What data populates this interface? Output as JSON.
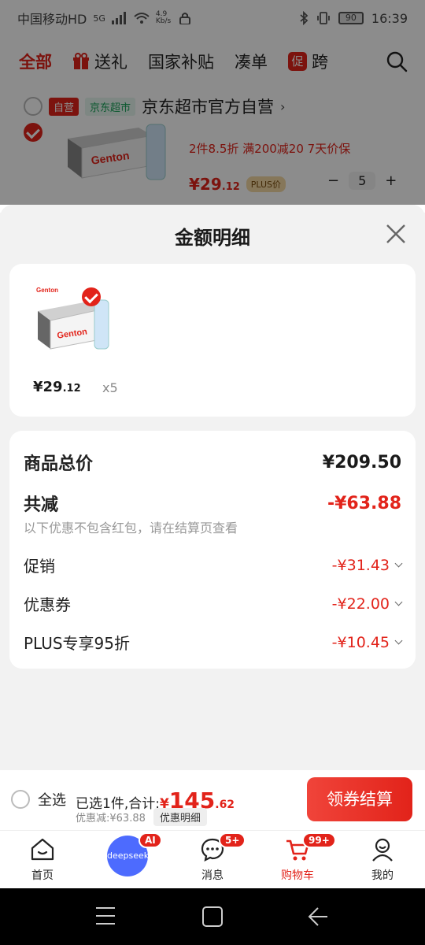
{
  "status_bar": {
    "carrier": "中国移动HD",
    "signal": "5G",
    "speed": "4.9 Kb/s",
    "battery": "90",
    "time": "16:39"
  },
  "top_tabs": [
    {
      "label": "全部",
      "active": true
    },
    {
      "label": "送礼",
      "icon": "gift-icon"
    },
    {
      "label": "国家补贴"
    },
    {
      "label": "凑单"
    },
    {
      "label": "跨",
      "badge": "促"
    }
  ],
  "cart_bg": {
    "self_badge": "自营",
    "jd_badge": "京东超市",
    "store_name": "京东超市官方自营",
    "promo": "2件8.5折   满200减20   7天价保",
    "price_symbol": "¥",
    "price_int": "29",
    "price_dec": ".12",
    "plus_badge": "PLUS价",
    "quantity": "5"
  },
  "sheet": {
    "title": "金额明细",
    "item": {
      "price_symbol": "¥",
      "price_int": "29",
      "price_dec": ".12",
      "qty": "x5"
    },
    "summary": {
      "total_label": "商品总价",
      "total_value": "¥209.50",
      "reduce_label": "共减",
      "reduce_value": "-¥63.88",
      "note": "以下优惠不包含红包，请在结算页查看",
      "rows": [
        {
          "label": "促销",
          "value": "-¥31.43"
        },
        {
          "label": "优惠券",
          "value": "-¥22.00"
        },
        {
          "label": "PLUS专享95折",
          "value": "-¥10.45"
        }
      ]
    }
  },
  "bottom_bar": {
    "select_all": "全选",
    "selected_text": "已选1件,合计:",
    "total_symbol": "¥",
    "total_int": "145",
    "total_dec": ".62",
    "discount_text": "优惠减:¥63.88",
    "detail_chip": "优惠明细",
    "checkout": "领券结算"
  },
  "nav": [
    {
      "label": "首页",
      "icon": "home-icon"
    },
    {
      "label": "deepseek",
      "icon": "deepseek-icon",
      "badge": "AI"
    },
    {
      "label": "消息",
      "icon": "message-icon",
      "badge": "5+"
    },
    {
      "label": "购物车",
      "icon": "cart-icon",
      "badge": "99+",
      "active": true
    },
    {
      "label": "我的",
      "icon": "profile-icon"
    }
  ],
  "colors": {
    "brand_red": "#e2231a",
    "plus_gold": "#f5d9a5",
    "deepseek_blue": "#4d6bfe"
  }
}
